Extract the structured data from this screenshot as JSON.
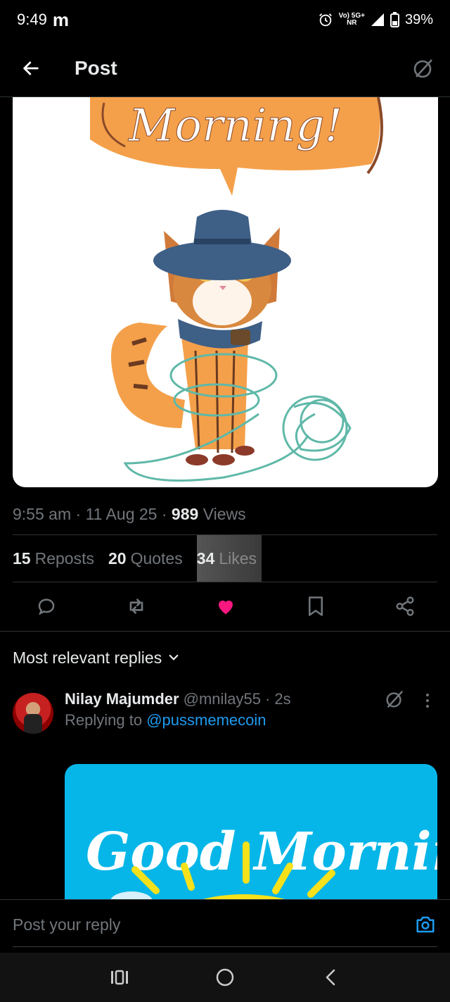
{
  "status_bar": {
    "time": "9:49",
    "app_indicator": "m",
    "network_top": "Vo) 5G+",
    "network_bottom": "NR",
    "battery": "39%"
  },
  "header": {
    "title": "Post"
  },
  "post": {
    "image_text": "Morning!",
    "time": "9:55 am",
    "date": "11 Aug 25",
    "views_count": "989",
    "views_label": "Views",
    "reposts_count": "15",
    "reposts_label": "Reposts",
    "quotes_count": "20",
    "quotes_label": "Quotes",
    "likes_count": "34",
    "likes_label": "Likes"
  },
  "replies_filter": {
    "label": "Most relevant replies"
  },
  "reply": {
    "name": "Nilay Majumder",
    "handle": "@mnilay55",
    "time": "2s",
    "replying_prefix": "Replying to",
    "replying_handle": "@pussmemecoin",
    "image_text": "Good Morning"
  },
  "composer": {
    "placeholder": "Post your reply"
  },
  "colors": {
    "accent": "#1d9bf0",
    "like": "#f91880",
    "muted": "#71767b",
    "reply_image_bg": "#06b6e8"
  }
}
